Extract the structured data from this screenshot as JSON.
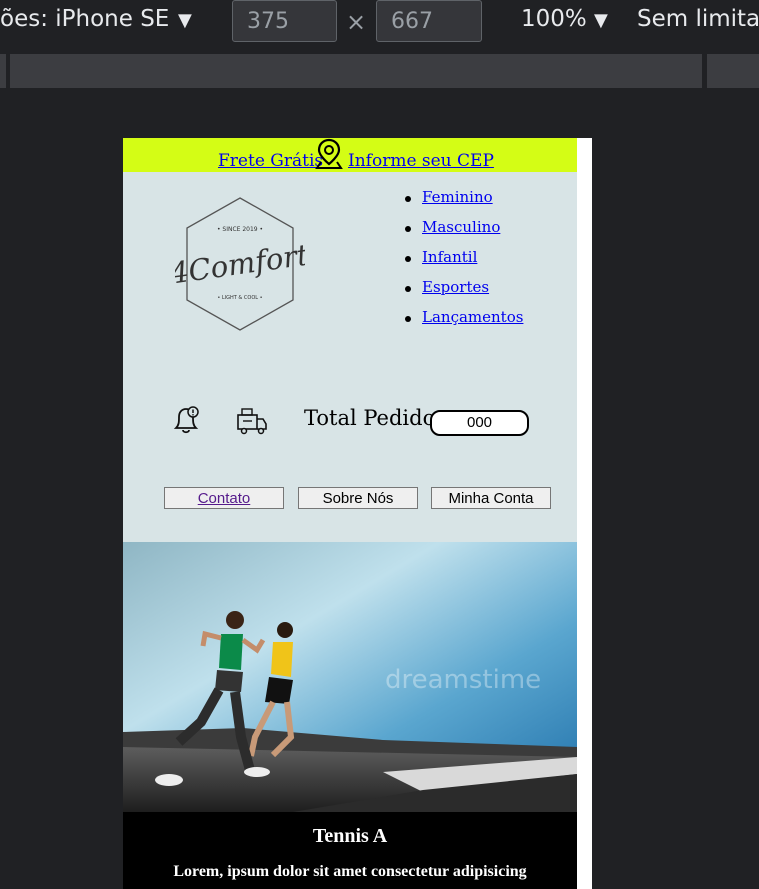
{
  "devtools": {
    "device_label": "ões: iPhone SE",
    "width_value": "375",
    "height_value": "667",
    "times_symbol": "×",
    "zoom": "100%",
    "throttle": "Sem limita"
  },
  "page": {
    "topbar": {
      "free_shipping": "Frete Grátis",
      "cep_link": "Informe seu CEP",
      "pin_icon": "map-pin-icon"
    },
    "logo": {
      "brand": "4Comfort",
      "since": "• SINCE 2019 •",
      "tagline": "• LIGHT & COOL •"
    },
    "nav": [
      "Feminino",
      "Masculino",
      "Infantil",
      "Esportes",
      "Lançamentos"
    ],
    "order": {
      "bell_icon": "bell-icon",
      "truck_icon": "delivery-truck-icon",
      "total_label": "Total Pedido",
      "total_value": "000"
    },
    "buttons": {
      "contact": "Contato",
      "about": "Sobre Nós",
      "account": "Minha Conta"
    },
    "hero": {
      "alt": "runners-photo",
      "watermark": "dreamstime"
    },
    "product": {
      "title": "Tennis A",
      "description": "Lorem, ipsum dolor sit amet consectetur adipisicing"
    }
  },
  "colors": {
    "topbar": "#d4fd15",
    "page_background": "#d8e4e6",
    "devtools_background": "#202124",
    "link": "#0000ee"
  }
}
